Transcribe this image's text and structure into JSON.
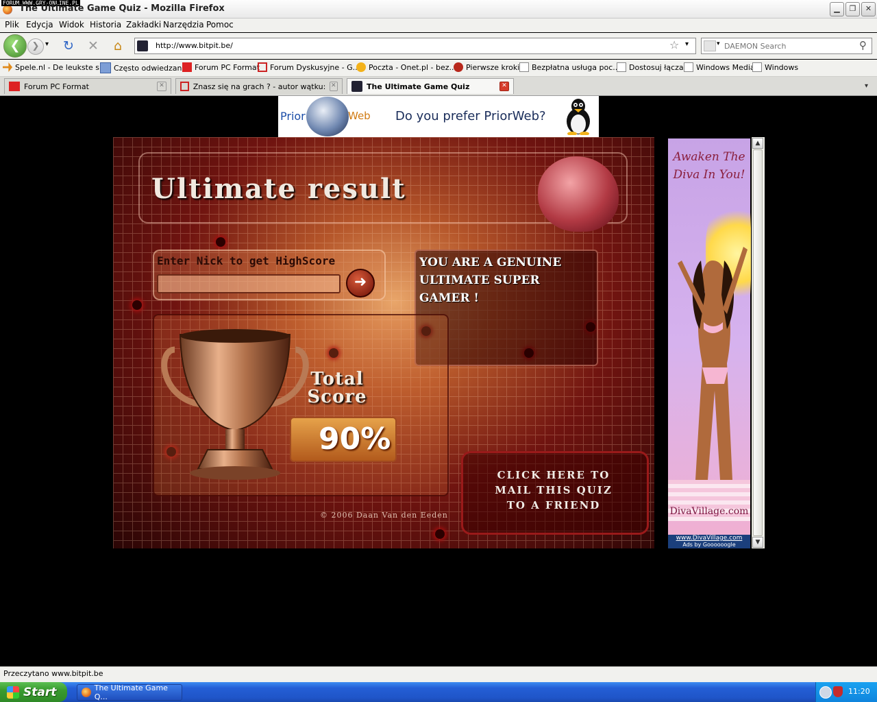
{
  "window": {
    "watermark": "FORUM WWW.GRY-ONLINE.PL",
    "title": "The Ultimate Game Quiz - Mozilla Firefox",
    "min_glyph": "▁",
    "max_glyph": "❐",
    "close_glyph": "✕"
  },
  "menu": [
    "Plik",
    "Edycja",
    "Widok",
    "Historia",
    "Zakładki",
    "Narzędzia",
    "Pomoc"
  ],
  "nav": {
    "url": "http://www.bitpit.be/",
    "search_placeholder": "DAEMON Search",
    "back_glyph": "❮",
    "forward_glyph": "❯",
    "reload_glyph": "↻",
    "stop_glyph": "✕",
    "home_glyph": "⌂",
    "star_glyph": "☆",
    "dropdown_glyph": "▾",
    "search_glyph": "⚲"
  },
  "bookmarks": [
    "Spele.nl - De leukste s...",
    "Często odwiedzane",
    "Forum PC Format",
    "Forum Dyskusyjne - G...",
    "Poczta - Onet.pl - bez...",
    "Pierwsze kroki",
    "Bezpłatna usługa poc...",
    "Dostosuj łącza",
    "Windows Media",
    "Windows"
  ],
  "tabs": [
    {
      "label": "Forum PC Format",
      "icon": "pcf-icon"
    },
    {
      "label": "Znasz się na grach ? - autor wątku: Bu...",
      "icon": "g-icon"
    },
    {
      "label": "The Ultimate Game Quiz",
      "icon": "site-icon"
    }
  ],
  "banner": {
    "prior": "Prior",
    "web": "Web",
    "text": "Do you prefer PriorWeb?"
  },
  "game": {
    "title": "Ultimate result",
    "nick_label": "Enter Nick to get HighScore",
    "submit_glyph": "➜",
    "verdict_line1": "YOU ARE A GENUINE",
    "verdict_line2": "ULTIMATE SUPER",
    "verdict_line3": "GAMER !",
    "total_label_1": "Total",
    "total_label_2": "Score",
    "score": "90%",
    "mail_line1": "CLICK HERE TO",
    "mail_line2": "MAIL THIS QUIZ",
    "mail_line3": "TO A FRIEND",
    "copyright": "© 2006 Daan Van den Eeden"
  },
  "ad": {
    "line1": "Awaken The",
    "line2": "Diva In You!",
    "brand": "DivaVillage.com",
    "url": "www.DivaVillage.com",
    "by": "Ads by Goooooogle"
  },
  "status": "Przeczytano www.bitpit.be",
  "taskbar": {
    "start": "Start",
    "task": "The Ultimate Game Q...",
    "clock": "11:20"
  },
  "colors": {
    "accent_green": "#3f8a2a",
    "tab_close_red": "#d63b2a",
    "taskbar_blue": "#245ed6"
  }
}
